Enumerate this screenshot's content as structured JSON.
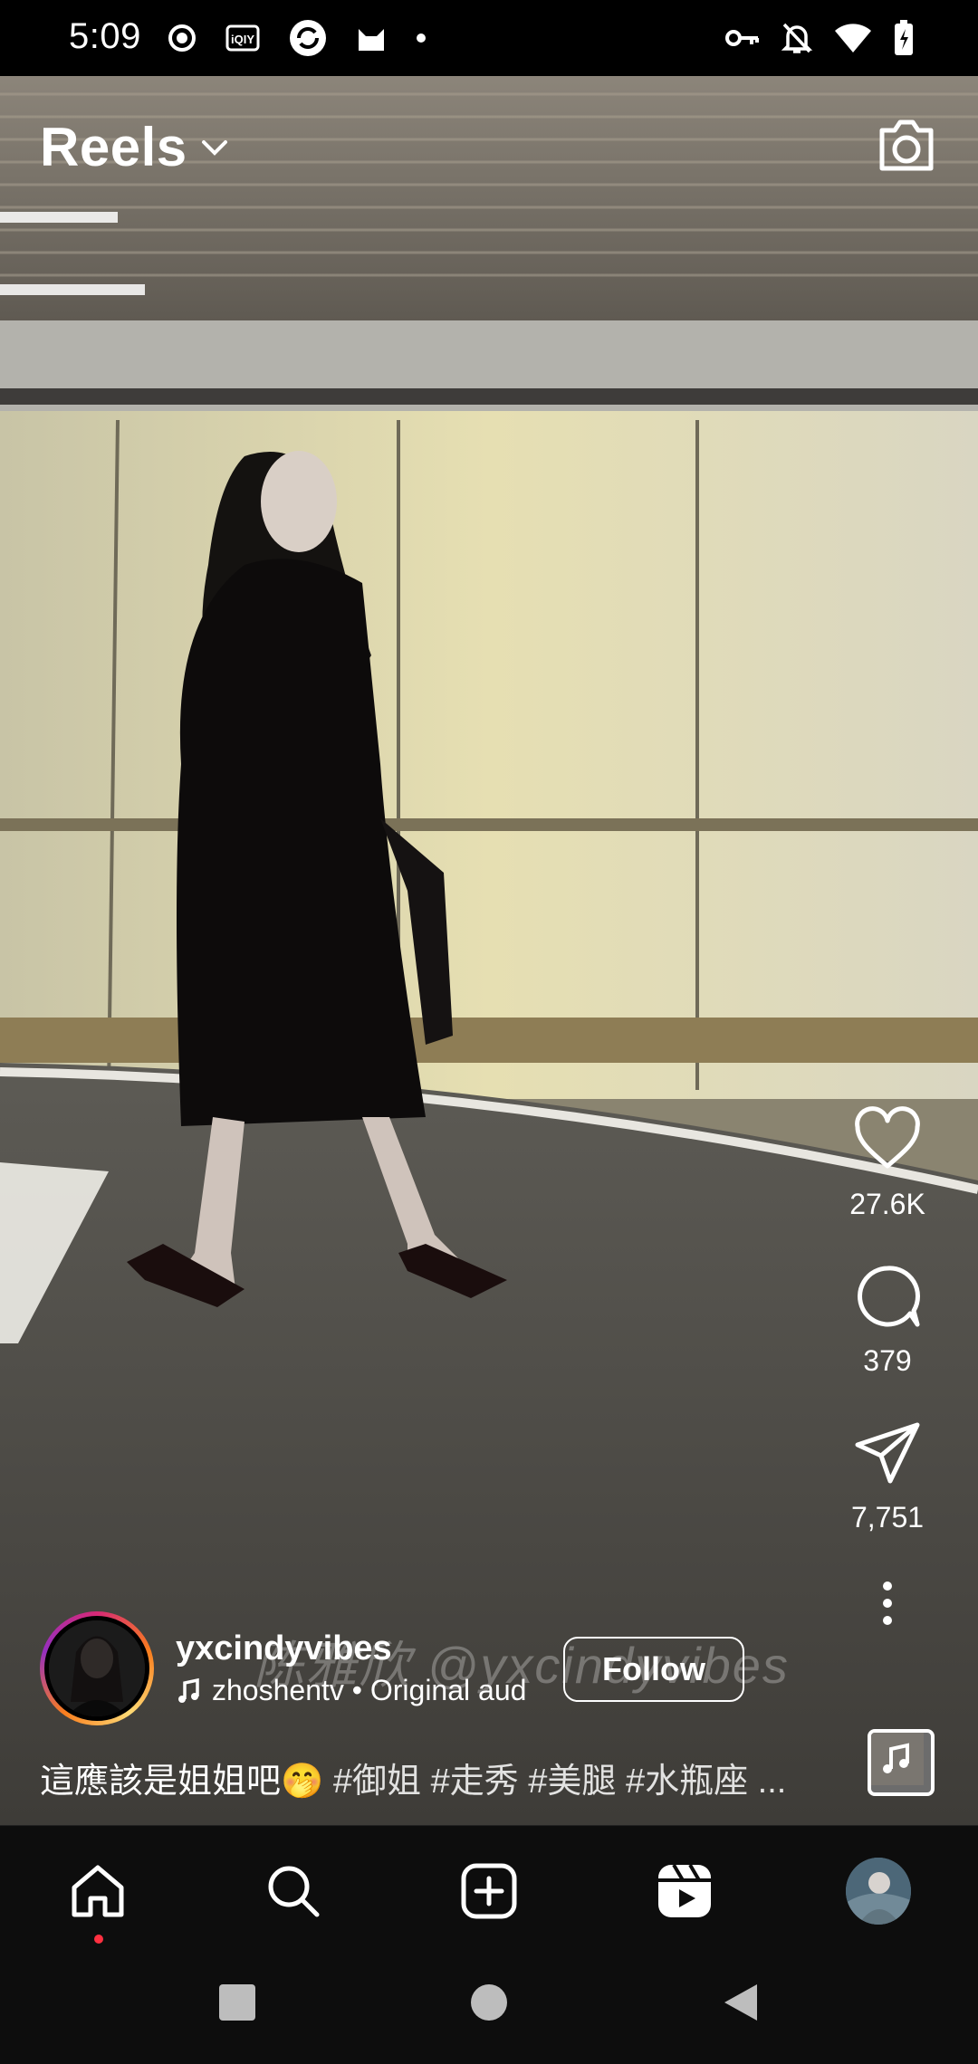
{
  "status_bar": {
    "time": "5:09",
    "left_icons": [
      "record-icon",
      "iqiyi-icon",
      "sync-app-icon",
      "cat-app-icon",
      "dot-icon"
    ],
    "right_icons": [
      "key-icon",
      "bell-off-icon",
      "wifi-icon",
      "battery-charging-icon"
    ]
  },
  "header": {
    "title": "Reels",
    "dropdown_icon": "chevron-down-icon",
    "camera_icon": "camera-icon"
  },
  "actions": {
    "likes": "27.6K",
    "comments": "379",
    "shares": "7,751"
  },
  "author": {
    "username": "yxcindyvibes",
    "audio": "zhoshentv • Original aud",
    "follow_label": "Follow"
  },
  "watermark": "陈雅欣 @yxcindyvibes",
  "caption": {
    "text": "這應該是姐姐吧🤭",
    "hashtags": " #御姐 #走秀 #美腿 #水瓶座 ..."
  },
  "bottom_nav": [
    "home-icon",
    "search-icon",
    "create-icon",
    "reels-icon",
    "profile-avatar"
  ],
  "colors": {
    "background": "#000000",
    "nav_background": "#0d0d0d",
    "notification_dot": "#ff3040"
  }
}
